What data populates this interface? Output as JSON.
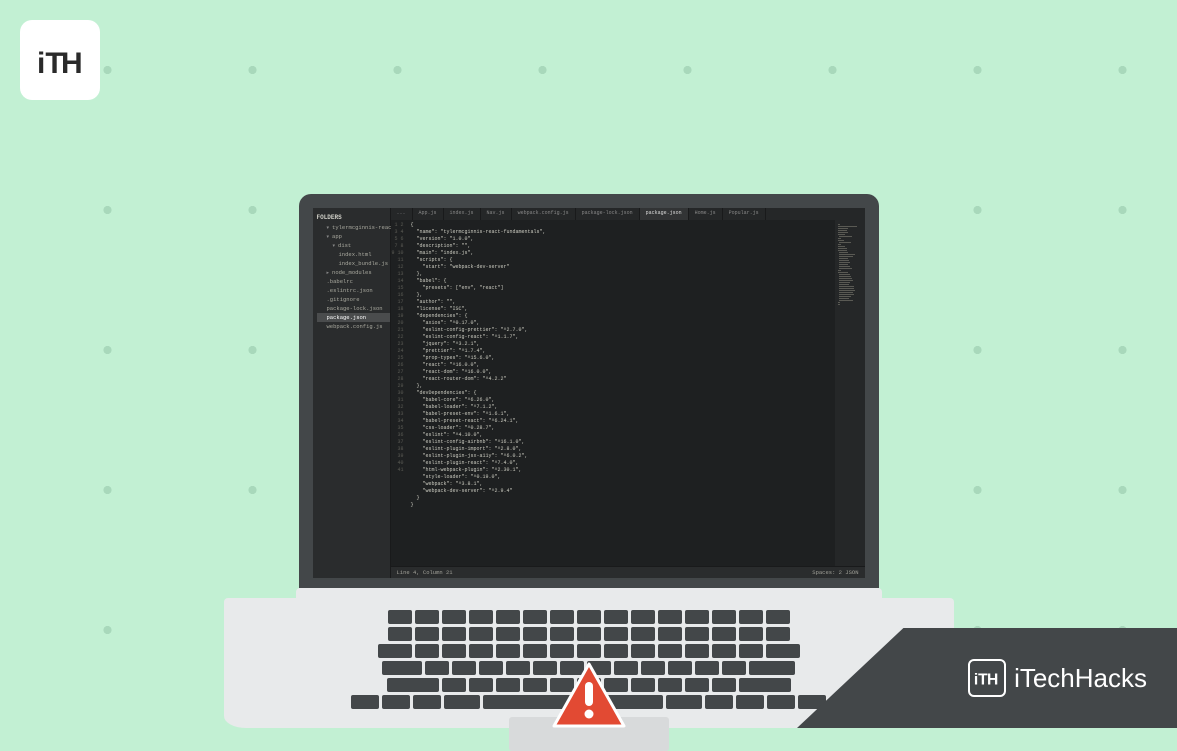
{
  "brand": {
    "corner_logo_text": "iTH",
    "banner_text": "iTechHacks",
    "banner_logo_text": "iTH"
  },
  "editor": {
    "sidebar_title": "FOLDERS",
    "project_name": "tylermcginnis-react",
    "tree": [
      {
        "type": "folder",
        "label": "app",
        "open": true,
        "children": [
          {
            "type": "folder",
            "label": "dist",
            "open": true,
            "children": [
              {
                "type": "file",
                "label": "index.html"
              },
              {
                "type": "file",
                "label": "index_bundle.js"
              }
            ]
          }
        ]
      },
      {
        "type": "folder",
        "label": "node_modules",
        "open": false
      },
      {
        "type": "file",
        "label": ".babelrc"
      },
      {
        "type": "file",
        "label": ".eslintrc.json"
      },
      {
        "type": "file",
        "label": ".gitignore"
      },
      {
        "type": "file",
        "label": "package-lock.json"
      },
      {
        "type": "file",
        "label": "package.json",
        "active": true
      },
      {
        "type": "file",
        "label": "webpack.config.js"
      }
    ],
    "tabs": [
      {
        "label": "...",
        "active": false
      },
      {
        "label": "App.js",
        "active": false
      },
      {
        "label": "index.js",
        "active": false
      },
      {
        "label": "Nav.js",
        "active": false
      },
      {
        "label": "webpack.config.js",
        "active": false
      },
      {
        "label": "package-lock.json",
        "active": false
      },
      {
        "label": "package.json",
        "active": true
      },
      {
        "label": "Home.js",
        "active": false
      },
      {
        "label": "Popular.js",
        "active": false
      }
    ],
    "code_lines": [
      "{",
      "  \"name\": \"tylermcginnis-react-fundamentals\",",
      "  \"version\": \"1.0.0\",",
      "  \"description\": \"\",",
      "  \"main\": \"index.js\",",
      "  \"scripts\": {",
      "    \"start\": \"webpack-dev-server\"",
      "  },",
      "  \"babel\": {",
      "    \"presets\": [\"env\", \"react\"]",
      "  },",
      "  \"author\": \"\",",
      "  \"license\": \"ISC\",",
      "  \"dependencies\": {",
      "    \"axios\": \"^0.17.0\",",
      "    \"eslint-config-prettier\": \"^2.7.0\",",
      "    \"eslint-config-react\": \"^1.1.7\",",
      "    \"jquery\": \"^3.2.1\",",
      "    \"prettier\": \"^1.7.4\",",
      "    \"prop-types\": \"^15.6.0\",",
      "    \"react\": \"^16.0.0\",",
      "    \"react-dom\": \"^16.0.0\",",
      "    \"react-router-dom\": \"^4.2.2\"",
      "  },",
      "  \"devDependencies\": {",
      "    \"babel-core\": \"^6.26.0\",",
      "    \"babel-loader\": \"^7.1.2\",",
      "    \"babel-preset-env\": \"^1.6.1\",",
      "    \"babel-preset-react\": \"^6.24.1\",",
      "    \"css-loader\": \"^0.28.7\",",
      "    \"eslint\": \"^4.10.0\",",
      "    \"eslint-config-airbnb\": \"^16.1.0\",",
      "    \"eslint-plugin-import\": \"^2.8.0\",",
      "    \"eslint-plugin-jsx-a11y\": \"^6.0.2\",",
      "    \"eslint-plugin-react\": \"^7.4.0\",",
      "    \"html-webpack-plugin\": \"^2.30.1\",",
      "    \"style-loader\": \"^0.19.0\",",
      "    \"webpack\": \"^3.8.1\",",
      "    \"webpack-dev-server\": \"^2.9.4\"",
      "  }",
      "}"
    ],
    "statusbar": {
      "left": "Line 4, Column 21",
      "right": "Spaces: 2    JSON"
    }
  },
  "colors": {
    "bg": "#c2f0d3",
    "laptop": "#434749",
    "base": "#e8eaeb",
    "editor_bg": "#1e2021",
    "alert": "#e24a33"
  }
}
